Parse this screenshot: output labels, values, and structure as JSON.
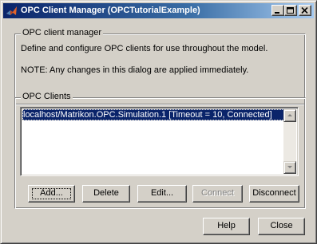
{
  "window": {
    "title": "OPC Client Manager (OPCTutorialExample)",
    "icon": "matlab-logo-icon",
    "controls": [
      "minimize-icon",
      "maximize-icon",
      "close-icon"
    ]
  },
  "manager_group": {
    "label": "OPC client manager",
    "description": "Define and configure OPC clients for use throughout the model.",
    "note": "NOTE: Any changes in this dialog are applied immediately."
  },
  "clients_group": {
    "label": "OPC Clients",
    "items": [
      "localhost/Matrikon.OPC.Simulation.1 [Timeout = 10, Connected]"
    ],
    "selected_index": 0,
    "buttons": {
      "add": "Add...",
      "delete": "Delete",
      "edit": "Edit...",
      "connect": "Connect",
      "disconnect": "Disconnect"
    },
    "connect_enabled": false
  },
  "footer": {
    "help": "Help",
    "close": "Close"
  },
  "colors": {
    "titlebar_start": "#0a246a",
    "titlebar_end": "#a6caf0",
    "face": "#d4d0c8",
    "selection": "#0a246a"
  }
}
